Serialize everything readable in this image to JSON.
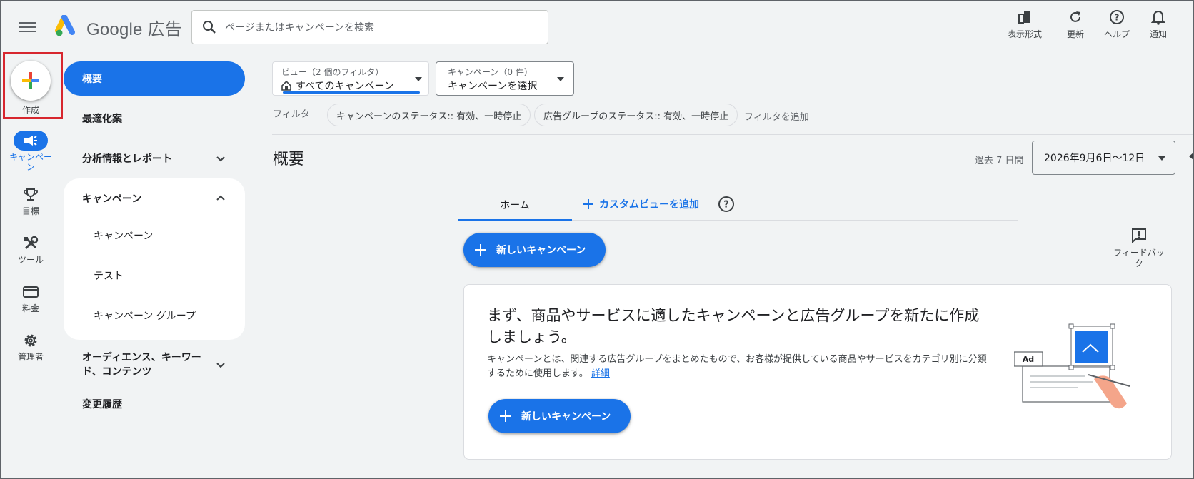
{
  "topbar": {
    "brand": "Google 広告",
    "search_placeholder": "ページまたはキャンペーンを検索",
    "actions": [
      "表示形式",
      "更新",
      "ヘルプ",
      "通知"
    ]
  },
  "rail": {
    "create_label": "作成",
    "items": [
      "キャンペーン",
      "目標",
      "ツール",
      "料金",
      "管理者"
    ]
  },
  "nav": {
    "overview": "概要",
    "recommendations": "最適化案",
    "insights": "分析情報とレポート",
    "campaigns_group": "キャンペーン",
    "campaigns_sub": [
      "キャンペーン",
      "テスト",
      "キャンペーン グループ"
    ],
    "audiences_line1": "オーディエンス、キーワー",
    "audiences_line2": "ド、コンテンツ",
    "change_history": "変更履歴"
  },
  "view_select": {
    "label": "ビュー（2 個のフィルタ）",
    "value": "すべてのキャンペーン"
  },
  "campaign_select": {
    "label": "キャンペーン（0 件）",
    "value": "キャンペーンを選択"
  },
  "filters": {
    "label": "フィルタ",
    "chips": [
      "キャンペーンのステータス:: 有効、一時停止",
      "広告グループのステータス:: 有効、一時停止"
    ],
    "add": "フィルタを追加"
  },
  "page": {
    "title": "概要",
    "date_label": "過去 7 日間",
    "date_value": "2026年9月6日〜12日"
  },
  "tabs": {
    "home": "ホーム",
    "add_custom": "カスタムビューを追加"
  },
  "new_campaign_button": "新しいキャンペーン",
  "feedback": {
    "line1": "フィードバッ",
    "line2": "ク"
  },
  "card": {
    "title": "まず、商品やサービスに適したキャンペーンと広告グループを新たに作成しましょう。",
    "description": "キャンペーンとは、関連する広告グループをまとめたもので、お客様が提供している商品やサービスをカテゴリ別に分類するために使用します。",
    "link": "詳細",
    "button": "新しいキャンペーン",
    "illustration_ad_label": "Ad"
  },
  "colors": {
    "primary": "#1a73e8",
    "highlight_border": "#d7262e",
    "background": "#f1f3f4"
  }
}
